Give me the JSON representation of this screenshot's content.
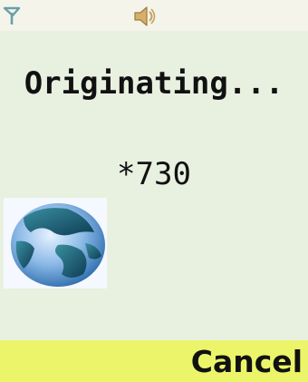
{
  "status_bar": {
    "signal_icon": "signal-antenna-icon",
    "sound_icon": "speaker-icon"
  },
  "call": {
    "status_text": "Originating...",
    "dialed_number": "*730",
    "image_icon": "globe-icon"
  },
  "softkeys": {
    "right_label": "Cancel"
  },
  "colors": {
    "status_bar_bg": "#f4f4ea",
    "screen_bg": "#e8f0e0",
    "softkey_bg": "#ecf56a",
    "text": "#111111"
  }
}
